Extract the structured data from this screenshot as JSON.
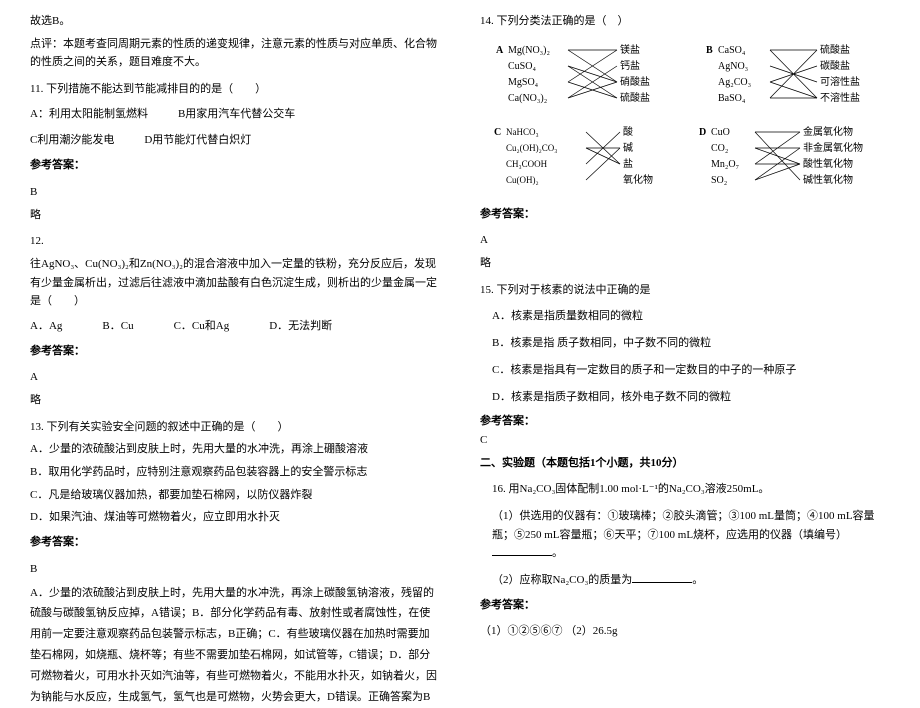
{
  "left": {
    "intro1": "故选B。",
    "intro2": "点评：本题考查同周期元素的性质的递变规律，注意元素的性质与对应单质、化合物的性质之间的关系，题目难度不大。",
    "q11": {
      "stem": "11. 下列措施不能达到节能减排目的的是（　　）",
      "optA": "A：利用太阳能制氢燃料",
      "optB": "B用家用汽车代替公交车",
      "optC": "C利用潮汐能发电",
      "optD": "D用节能灯代替白炽灯",
      "ansLabel": "参考答案：",
      "ans": "B",
      "note": "略"
    },
    "q12": {
      "num": "12.",
      "stem": "往AgNO₃、Cu(NO₃)₂和Zn(NO₃)₂的混合溶液中加入一定量的铁粉，充分反应后，发现有少量金属析出，过滤后往滤液中滴加盐酸有白色沉淀生成，则析出的少量金属一定是（　　）",
      "optA": "A．Ag",
      "optB": "B．Cu",
      "optC": "C．Cu和Ag",
      "optD": "D．无法判断",
      "ansLabel": "参考答案：",
      "ans": "A",
      "note": "略"
    },
    "q13": {
      "stem": "13. 下列有关实验安全问题的叙述中正确的是（　　）",
      "optA": "A．少量的浓硫酸沾到皮肤上时，先用大量的水冲洗，再涂上硼酸溶液",
      "optB": "B．取用化学药品时，应特别注意观察药品包装容器上的安全警示标志",
      "optC": "C．凡是给玻璃仪器加热，都要加垫石棉网，以防仪器炸裂",
      "optD": "D．如果汽油、煤油等可燃物着火，应立即用水扑灭",
      "ansLabel": "参考答案：",
      "ans": "B",
      "expl": "A．少量的浓硫酸沾到皮肤上时，先用大量的水冲洗，再涂上碳酸氢钠溶液，残留的硫酸与碳酸氢钠反应掉，A错误；B．部分化学药品有毒、放射性或者腐蚀性，在使用前一定要注意观察药品包装警示标志，B正确；C．有些玻璃仪器在加热时需要加垫石棉网，如烧瓶、烧杯等；有些不需要加垫石棉网，如试管等，C错误；D．部分可燃物着火，可用水扑灭如汽油等，有些可燃物着火，不能用水扑灭，如钠着火，因为钠能与水反应，生成氢气，氢气也是可燃物，火势会更大，D错误。正确答案为B"
    }
  },
  "right": {
    "q14": {
      "stem": "14. 下列分类法正确的是（　）",
      "diagA": {
        "label": "A",
        "left": [
          "Mg(NO₃)₂",
          "CuSO₄",
          "MgSO₄",
          "Ca(NO₃)₂"
        ],
        "right": [
          "镁盐",
          "钙盐",
          "硝酸盐",
          "硫酸盐"
        ]
      },
      "diagB": {
        "label": "B",
        "left": [
          "CaSO₄",
          "AgNO₃",
          "Ag₂CO₃",
          "BaSO₄"
        ],
        "right": [
          "硫酸盐",
          "碳酸盐",
          "可溶性盐",
          "不溶性盐"
        ]
      },
      "diagC": {
        "label": "C",
        "left": [
          "NaHCO₃",
          "Cu₂(OH)₂CO₃",
          "CH₃COOH",
          "Cu(OH)₂"
        ],
        "right": [
          "酸",
          "碱",
          "盐",
          "氧化物"
        ]
      },
      "diagD": {
        "label": "D",
        "left": [
          "CuO",
          "CO₂",
          "Mn₂O₇",
          "SO₂"
        ],
        "right": [
          "金属氧化物",
          "非金属氧化物",
          "酸性氧化物",
          "碱性氧化物"
        ]
      },
      "ansLabel": "参考答案：",
      "ans": "A",
      "note": "略"
    },
    "q15": {
      "stem": "15. 下列对于核素的说法中正确的是",
      "optA": "A．核素是指质量数相同的微粒",
      "optB": "B．核素是指 质子数相同，中子数不同的微粒",
      "optC": "C．核素是指具有一定数目的质子和一定数目的中子的一种原子",
      "optD": "D．核素是指质子数相同，核外电子数不同的微粒",
      "ansLabel": "参考答案：",
      "ans": "C"
    },
    "section2": "二、实验题（本题包括1个小题，共10分）",
    "q16": {
      "stem": "16. 用Na₂CO₃固体配制1.00  mol·L⁻¹的Na₂CO₃溶液250mL。",
      "p1": "（1）供选用的仪器有：①玻璃棒；②胶头滴管；③100 mL量筒；④100 mL容量瓶；⑤250 mL容量瓶；⑥天平；⑦100 mL烧杯，应选用的仪器（填编号）",
      "p2pre": "（2）应称取Na₂CO₃的质量为",
      "p2post": "。",
      "ansLabel": "参考答案：",
      "ans": "（1）①②⑤⑥⑦ （2）26.5g"
    }
  }
}
